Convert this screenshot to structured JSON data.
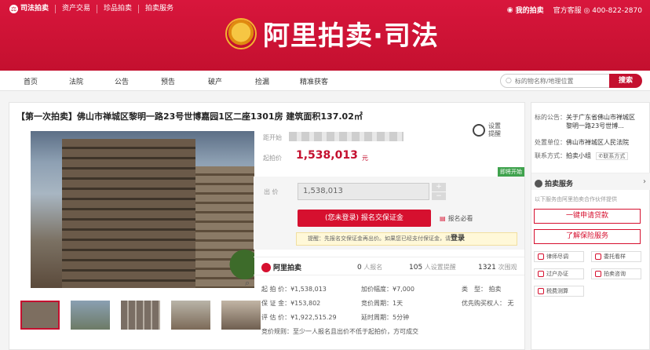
{
  "top_nav": {
    "brand": "司法拍卖",
    "items": [
      "资产交易",
      "珍品拍卖",
      "拍卖服务"
    ],
    "my_auction": "我的拍卖",
    "service": "官方客服",
    "phone": "400-822-2870"
  },
  "logo": {
    "text": "阿里拍卖·司法"
  },
  "nav": {
    "items": [
      "首页",
      "法院",
      "公告",
      "预告",
      "破产",
      "捡漏",
      "精准获客"
    ],
    "search_placeholder": "标的物名称/地理位置",
    "search_button": "搜索"
  },
  "item": {
    "title": "【第一次拍卖】佛山市禅城区黎明一路23号世博嘉园1区二座1301房 建筑面积137.02㎡",
    "start_label": "距开始",
    "start_price_label": "起拍价",
    "start_price": "1,538,013",
    "price_unit": "元",
    "remind": [
      "设置",
      "提醒"
    ],
    "soon_badge": "即将开始",
    "bid_label": "出 价",
    "bid_value": "1,538,013",
    "register_button": "(您未登录) 报名交保证金",
    "must_see": "报名必看",
    "tip_prefix": "提醒：先报名交保证金再出价。如果您已经支付保证金，请",
    "tip_login": "登录"
  },
  "stats": {
    "brand": "阿里拍卖",
    "registered_count": "0",
    "registered_label": "人报名",
    "reminders_count": "105",
    "reminders_label": "人设置提醒",
    "views_count": "1321",
    "views_label": "次围观"
  },
  "details": {
    "start_price": "起 拍 价：¥1,538,013",
    "deposit": "保 证 金：¥153,802",
    "appraisal": "评 估 价：¥1,922,515.29",
    "increment": "加价幅度：¥7,000",
    "cycle": "竞价周期：1天",
    "extension": "延时周期：5分钟",
    "type_label": "类　型：",
    "type_value": "拍卖",
    "priority_label": "优先购买权人：",
    "priority_value": "无",
    "rule": "竞价规则：至少一人报名且出价不低于起拍价，方可成交"
  },
  "side": {
    "notice_label": "标的公告：",
    "notice_text": [
      "关于广东省佛山市禅城区",
      "黎明一路23号世博..."
    ],
    "court_label": "处置单位：",
    "court": "佛山市禅城区人民法院",
    "contact_label": "联系方式：",
    "contact_value": "拍卖小组",
    "contact_button": "联系方式",
    "service_title": "拍卖服务",
    "service_sub": "以下服务由阿里拍卖合作伙伴提供",
    "loan_button": "一键申请贷款",
    "insurance_button": "了解保险服务",
    "mini": [
      "律师尽调",
      "委托看样",
      "过户办证",
      "拍卖咨询",
      "税费测算"
    ]
  }
}
